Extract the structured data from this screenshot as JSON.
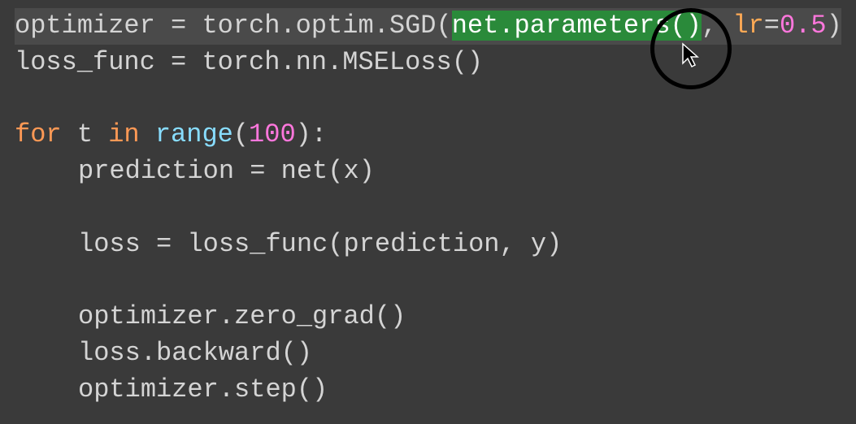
{
  "code": {
    "line1": {
      "var": "optimizer",
      "eq": " = ",
      "call": "torch.optim.SGD(",
      "selected": "net.parameters()",
      "comma": ", ",
      "kwname": "lr",
      "kweq": "=",
      "kwval": "0.5",
      "close": ")"
    },
    "line2": {
      "var": "loss_func",
      "eq": " = ",
      "call": "torch.nn.MSELoss()"
    },
    "line3": "",
    "line4": {
      "kw1": "for",
      "sp1": " ",
      "var": "t",
      "sp2": " ",
      "kw2": "in",
      "sp3": " ",
      "fn": "range",
      "open": "(",
      "num": "100",
      "close": "):"
    },
    "line5": {
      "text": "prediction = net(x)"
    },
    "line6": "",
    "line7": {
      "text": "loss = loss_func(prediction, y)"
    },
    "line8": "",
    "line9": {
      "text": "optimizer.zero_grad()"
    },
    "line10": {
      "text": "loss.backward()"
    },
    "line11": {
      "text": "optimizer.step()"
    }
  }
}
